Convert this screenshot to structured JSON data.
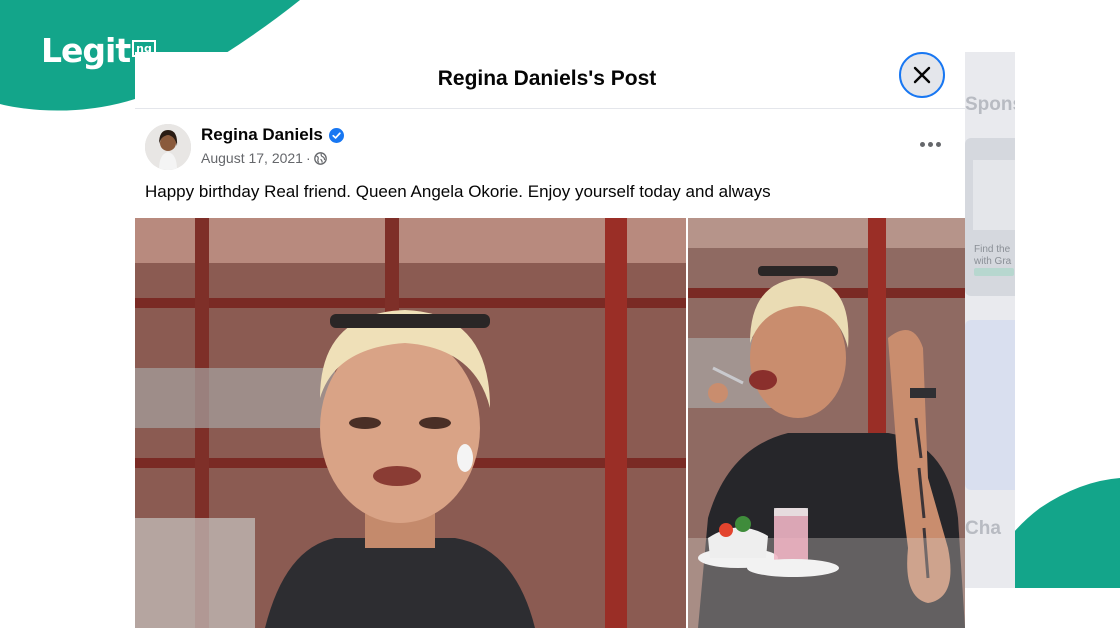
{
  "brand": {
    "name": "Legit",
    "suffix": "ng",
    "accent": "#13a58a"
  },
  "post": {
    "modal_title": "Regina Daniels's Post",
    "author": "Regina Daniels",
    "date": "August 17, 2021",
    "separator": "·",
    "privacy_icon": "globe-icon",
    "caption": "Happy birthday Real friend. Queen Angela Okorie. Enjoy yourself today and always"
  },
  "side": {
    "sponsored_partial": "Spons",
    "card_text_line1": "Find the",
    "card_text_line2": "with Gra",
    "chats_partial": "Cha"
  },
  "colors": {
    "verified": "#1877f2",
    "close_ring": "#1877f2"
  }
}
